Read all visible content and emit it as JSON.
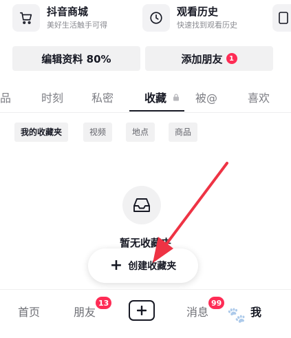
{
  "features": [
    {
      "icon": "cart-icon",
      "title": "抖音商城",
      "subtitle": "美好生活触手可得"
    },
    {
      "icon": "clock-icon",
      "title": "观看历史",
      "subtitle": "快速找到观看历史"
    }
  ],
  "actions": {
    "edit_profile": "编辑资料 80%",
    "add_friends": "添加朋友",
    "add_friends_badge": "1"
  },
  "tabs": {
    "works_partial": "品",
    "moments": "时刻",
    "private": "私密",
    "favorites": "收藏",
    "mentioned": "被@",
    "likes": "喜欢"
  },
  "chips": [
    "我的收藏夹",
    "视频",
    "地点",
    "商品"
  ],
  "empty_state": {
    "text": "暂无收藏夹",
    "create_button": "创建收藏夹",
    "icon": "inbox-tray-icon"
  },
  "bottom_nav": {
    "home": "首页",
    "friends": "朋友",
    "friends_badge": "13",
    "messages": "消息",
    "messages_badge": "99",
    "me": "我"
  },
  "colors": {
    "accent": "#fe2c55",
    "annotation_arrow": "#ee3344",
    "text_primary": "#161823",
    "text_secondary": "#8a8b91"
  }
}
